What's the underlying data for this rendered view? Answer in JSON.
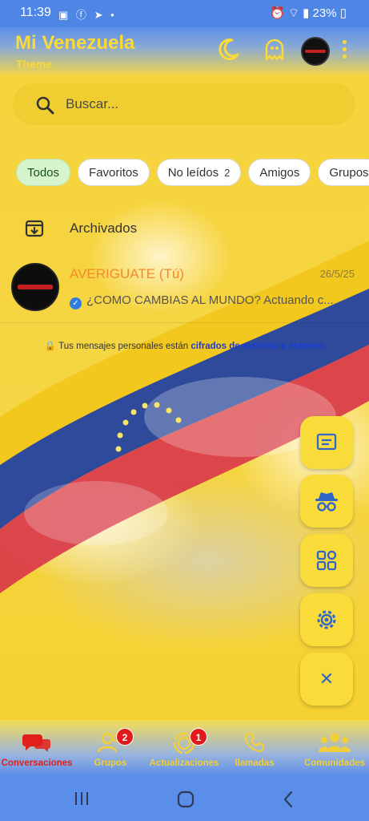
{
  "status_bar": {
    "time": "11:39",
    "left_icons": [
      "image-icon",
      "facebook-icon",
      "telegram-icon",
      "dot-icon"
    ],
    "battery": "23%",
    "right_icons": [
      "alarm-icon",
      "wifi-icon",
      "signal-icon",
      "battery-icon"
    ]
  },
  "header": {
    "title": "Mi Venezuela",
    "subtitle": "Theme",
    "icons": [
      "moon-icon",
      "ghost-icon",
      "profile-avatar",
      "more-vert-icon"
    ]
  },
  "search": {
    "placeholder": "Buscar..."
  },
  "filters": [
    {
      "label": "Todos",
      "active": true
    },
    {
      "label": "Favoritos"
    },
    {
      "label": "No leídos",
      "count": "2"
    },
    {
      "label": "Amigos"
    },
    {
      "label": "Grupos"
    }
  ],
  "archived": {
    "label": "Archivados"
  },
  "chats": [
    {
      "name": "AVERIGUATE (Tú)",
      "time": "26/5/25",
      "message": "¿COMO CAMBIAS AL MUNDO? Actuando c..."
    }
  ],
  "encryption": {
    "text": "Tus mensajes personales están",
    "link": "cifrados de extremo a extremo"
  },
  "fab_menu": [
    "message-icon",
    "incognito-icon",
    "apps-grid-icon",
    "settings-gear-icon",
    "close-icon"
  ],
  "bottom_nav": [
    {
      "label": "Conversaciones",
      "active": true,
      "icon": "chat-bubbles-icon"
    },
    {
      "label": "Grupos",
      "badge": "2",
      "icon": "group-icon"
    },
    {
      "label": "Actualizaciones",
      "badge": "1",
      "icon": "status-icon"
    },
    {
      "label": "llamadas",
      "icon": "phone-icon"
    },
    {
      "label": "Comunidades",
      "icon": "communities-icon"
    }
  ],
  "colors": {
    "accent_yellow": "#f9da38",
    "status_blue": "#4f86e6",
    "flag_red": "#d9384a",
    "flag_blue": "#2f4a9a",
    "active_red": "#e0201b",
    "chat_name": "#f28a2c",
    "link": "#1a3ad6"
  }
}
